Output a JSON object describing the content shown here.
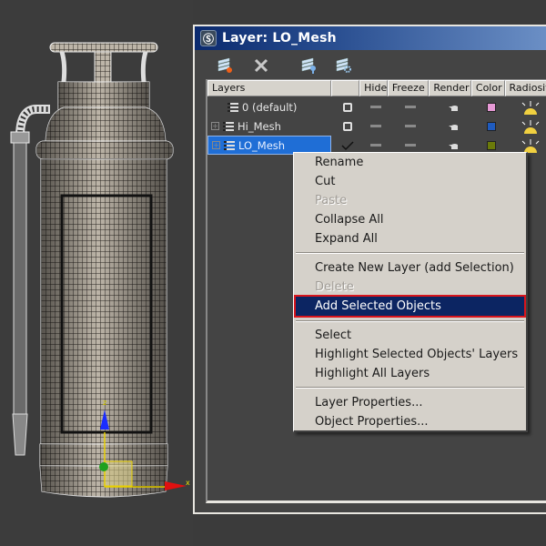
{
  "window": {
    "title": "Layer: LO_Mesh",
    "app_icon": "3ds-max-icon"
  },
  "toolbar": {
    "buttons": [
      {
        "name": "create-new-layer-button",
        "icon": "layer-new-icon"
      },
      {
        "name": "delete-layer-button",
        "icon": "close-x-icon"
      },
      {
        "name": "add-selection-to-layer-button",
        "icon": "layer-add-icon"
      },
      {
        "name": "layer-settings-button",
        "icon": "layer-gear-icon"
      }
    ]
  },
  "columns": [
    "Layers",
    "",
    "Hide",
    "Freeze",
    "Render",
    "Color",
    "Radiosit"
  ],
  "layers": [
    {
      "name": "0 (default)",
      "expandable": false,
      "current": "box",
      "color": "#e79ad6",
      "selected": false
    },
    {
      "name": "Hi_Mesh",
      "expandable": true,
      "current": "box",
      "color": "#1f5bbf",
      "selected": false
    },
    {
      "name": "LO_Mesh",
      "expandable": true,
      "current": "check",
      "color": "#6b7a0a",
      "selected": true
    }
  ],
  "context_menu": {
    "groups": [
      [
        {
          "label": "Rename",
          "disabled": false
        },
        {
          "label": "Cut",
          "disabled": false
        },
        {
          "label": "Paste",
          "disabled": true
        },
        {
          "label": "Collapse All",
          "disabled": false
        },
        {
          "label": "Expand All",
          "disabled": false
        }
      ],
      [
        {
          "label": "Create New Layer (add Selection)",
          "disabled": false
        },
        {
          "label": "Delete",
          "disabled": true
        },
        {
          "label": "Add Selected Objects",
          "disabled": false,
          "highlighted": true
        }
      ],
      [
        {
          "label": "Select",
          "disabled": false
        },
        {
          "label": "Highlight Selected Objects' Layers",
          "disabled": false
        },
        {
          "label": "Highlight All Layers",
          "disabled": false
        }
      ],
      [
        {
          "label": "Layer Properties...",
          "disabled": false
        },
        {
          "label": "Object Properties...",
          "disabled": false
        }
      ]
    ]
  },
  "viewport": {
    "object": "fire extinguisher wireframe model",
    "gizmo_axes": [
      "z",
      "x"
    ],
    "axis_colors": {
      "z": "#1a2cff",
      "x": "#e01010",
      "y": "#1fa01f"
    }
  }
}
